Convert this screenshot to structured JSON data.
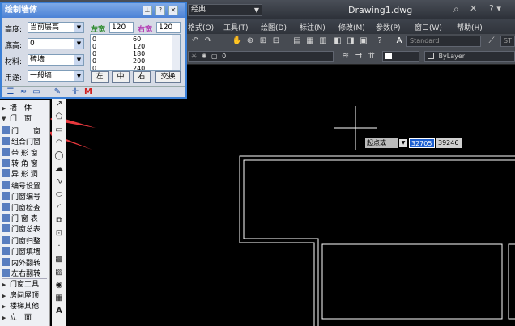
{
  "title_bar": {
    "workspace": "经典",
    "document_title": "Drawing1.dwg"
  },
  "menu": {
    "items": [
      "格式(O)",
      "工具(T)",
      "绘图(D)",
      "标注(N)",
      "修改(M)",
      "参数(P)",
      "窗口(W)",
      "帮助(H)"
    ]
  },
  "toolbar": {
    "text_style": "Standard",
    "layer_value": "0",
    "linetype": "ByLayer",
    "font_initial": "ST"
  },
  "dialog": {
    "title": "绘制墙体",
    "height_label": "高度:",
    "height_value": "当前层高",
    "base_label": "底高:",
    "base_value": "0",
    "material_label": "材料:",
    "material_value": "砖墙",
    "usage_label": "用途:",
    "usage_value": "一般墙",
    "left_width_label": "左宽",
    "left_width_value": "120",
    "right_width_label": "右宽",
    "right_width_value": "120",
    "list_rows": [
      {
        "a": "0",
        "b": "60"
      },
      {
        "a": "0",
        "b": "120"
      },
      {
        "a": "0",
        "b": "180"
      },
      {
        "a": "0",
        "b": "200"
      },
      {
        "a": "0",
        "b": "240"
      }
    ],
    "btn_left": "左",
    "btn_center": "中",
    "btn_right": "右",
    "btn_swap": "交换",
    "m_label": "M"
  },
  "palette": {
    "items": [
      {
        "label": "墙　体",
        "type": "tri-right"
      },
      {
        "label": "门　窗",
        "type": "tri-down"
      },
      {
        "label": "门　　窗",
        "type": "icon"
      },
      {
        "label": "组合门窗",
        "type": "icon"
      },
      {
        "label": "带 形 窗",
        "type": "icon"
      },
      {
        "label": "转 角 窗",
        "type": "icon"
      },
      {
        "label": "异 形 洞",
        "type": "icon"
      },
      {
        "label": "编号设置",
        "type": "icon"
      },
      {
        "label": "门窗编号",
        "type": "icon"
      },
      {
        "label": "门窗检查",
        "type": "icon"
      },
      {
        "label": "门 窗 表",
        "type": "icon"
      },
      {
        "label": "门窗总表",
        "type": "icon"
      },
      {
        "label": "门窗归整",
        "type": "icon"
      },
      {
        "label": "门窗填墙",
        "type": "icon"
      },
      {
        "label": "内外翻转",
        "type": "icon"
      },
      {
        "label": "左右翻转",
        "type": "icon"
      },
      {
        "label": "门窗工具",
        "type": "tri-right"
      },
      {
        "label": "房间屋顶",
        "type": "tri-right"
      },
      {
        "label": "楼梯其他",
        "type": "tri-right"
      },
      {
        "label": "立　面",
        "type": "tri-right"
      }
    ]
  },
  "dynamic_input": {
    "prompt": "起点或",
    "x_value": "32705",
    "y_value": "39246"
  },
  "colors": {
    "canvas": "#000000",
    "drawing_lines": "#ffffff",
    "annotation_arrow": "#e8383d",
    "dialog_title": "#4c82d6"
  }
}
